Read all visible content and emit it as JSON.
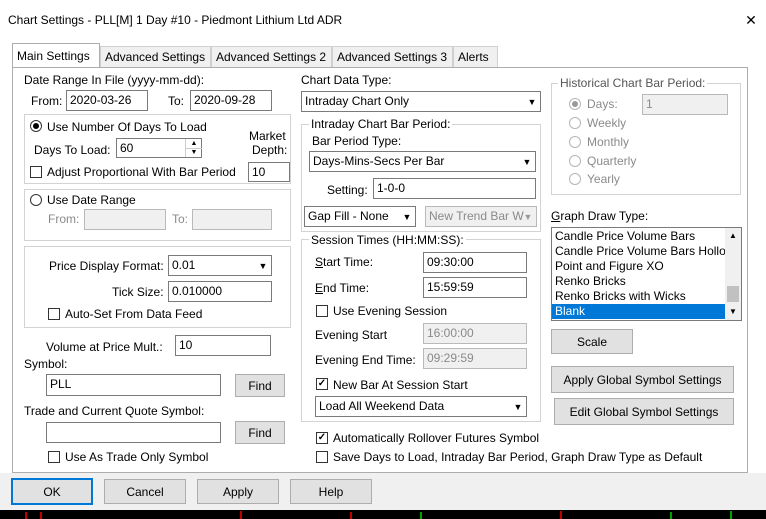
{
  "window": {
    "title": "Chart Settings - PLL[M]  1 Day   #10 - Piedmont Lithium Ltd ADR",
    "close_glyph": "✕"
  },
  "tabs": [
    {
      "label": "Main Settings",
      "active": true
    },
    {
      "label": "Advanced Settings",
      "active": false
    },
    {
      "label": "Advanced Settings 2",
      "active": false
    },
    {
      "label": "Advanced Settings 3",
      "active": false
    },
    {
      "label": "Alerts",
      "active": false
    }
  ],
  "date_range": {
    "heading": "Date Range In File (yyyy-mm-dd):",
    "from_label": "From:",
    "from_value": "2020-03-26",
    "to_label": "To:",
    "to_value": "2020-09-28"
  },
  "days_group": {
    "use_days_label": "Use Number Of Days To Load",
    "days_label": "Days To Load:",
    "days_value": "60",
    "market_depth_label_1": "Market",
    "market_depth_label_2": "Depth:",
    "market_depth_value": "10",
    "adjust_label": "Adjust Proportional With Bar Period"
  },
  "date_range_group": {
    "use_date_range_label": "Use Date Range",
    "from_label": "From:",
    "to_label": "To:"
  },
  "price_group": {
    "format_label": "Price Display Format:",
    "format_value": "0.01",
    "tick_label": "Tick Size:",
    "tick_value": "0.010000",
    "auto_set_label": "Auto-Set From Data Feed"
  },
  "volume": {
    "label": "Volume at Price Mult.:",
    "value": "10"
  },
  "symbol": {
    "label": "Symbol:",
    "value": "PLL",
    "find_label": "Find"
  },
  "trade_symbol": {
    "label": "Trade and Current Quote Symbol:",
    "value": "",
    "find_label": "Find",
    "trade_only_label": "Use As Trade Only Symbol"
  },
  "chart_data_type": {
    "label": "Chart Data Type:",
    "value": "Intraday Chart Only"
  },
  "intraday": {
    "group_label": "Intraday Chart Bar Period:",
    "bar_type_label": "Bar Period Type:",
    "bar_type_value": "Days-Mins-Secs Per Bar",
    "setting_label": "Setting:",
    "setting_value": "1-0-0",
    "gap_fill_value": "Gap Fill - None",
    "new_trend_value": "New Trend Bar W"
  },
  "session": {
    "group_label": "Session Times (HH:MM:SS):",
    "start_label": "Start Time:",
    "start_value": "09:30:00",
    "end_label": "End Time:",
    "end_value": "15:59:59",
    "evening_label": "Use Evening Session",
    "evening_start_label": "Evening Start",
    "evening_start_value": "16:00:00",
    "evening_end_label": "Evening End Time:",
    "evening_end_value": "09:29:59",
    "new_bar_label": "New Bar At Session Start",
    "weekend_value": "Load All Weekend Data"
  },
  "rollover_label": "Automatically Rollover Futures Symbol",
  "save_default_label": "Save Days to Load, Intraday Bar Period, Graph Draw Type as Default",
  "historical": {
    "group_label": "Historical Chart Bar Period:",
    "days_label": "Days:",
    "days_value": "1",
    "options": [
      "Weekly",
      "Monthly",
      "Quarterly",
      "Yearly"
    ]
  },
  "graph_draw": {
    "label": "Graph Draw Type:",
    "items": [
      "Candle Price Volume Bars",
      "Candle Price Volume Bars Hollo",
      "Point and Figure XO",
      "Renko Bricks",
      "Renko Bricks with Wicks",
      "Blank"
    ],
    "selected": "Blank"
  },
  "buttons": {
    "scale": "Scale",
    "apply_global": "Apply Global Symbol Settings",
    "edit_global": "Edit Global Symbol Settings",
    "ok": "OK",
    "cancel": "Cancel",
    "apply": "Apply",
    "help": "Help"
  },
  "colors": {
    "selection": "#0078d7",
    "button_face": "#e1e1e1",
    "footer_bg": "#f0f0f0"
  }
}
